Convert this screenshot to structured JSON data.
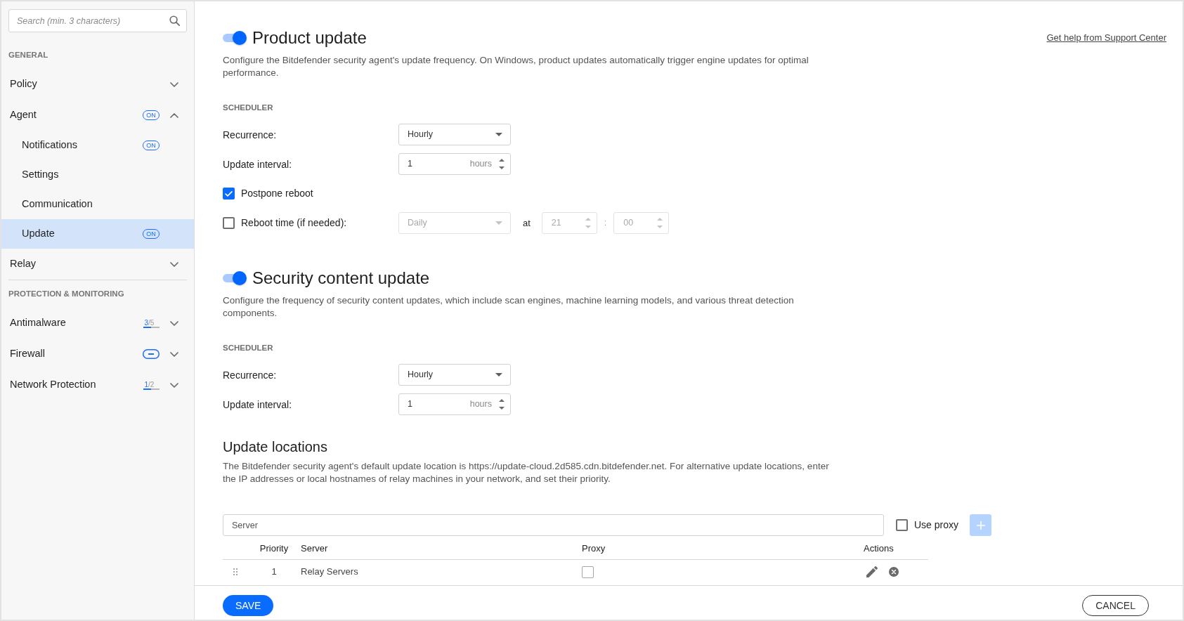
{
  "sidebar": {
    "search": {
      "placeholder": "Search (min. 3 characters)"
    },
    "sections": [
      {
        "heading": "GENERAL",
        "items": [
          {
            "label": "Policy",
            "selected": false,
            "expanded": false
          },
          {
            "label": "Agent",
            "selected": false,
            "expanded": true,
            "badge": {
              "kind": "on",
              "text": "ON"
            },
            "children": [
              {
                "label": "Notifications",
                "selected": false,
                "badge": {
                  "kind": "on",
                  "text": "ON"
                }
              },
              {
                "label": "Settings",
                "selected": false
              },
              {
                "label": "Communication",
                "selected": false
              },
              {
                "label": "Update",
                "selected": true,
                "badge": {
                  "kind": "on",
                  "text": "ON"
                }
              }
            ]
          },
          {
            "label": "Relay",
            "selected": false,
            "expanded": false
          }
        ]
      },
      {
        "heading": "PROTECTION & MONITORING",
        "items": [
          {
            "label": "Antimalware",
            "selected": false,
            "expanded": false,
            "badge": {
              "kind": "ratio",
              "count": "3",
              "total": "/5",
              "level": 0.5
            }
          },
          {
            "label": "Firewall",
            "selected": false,
            "expanded": false,
            "badge": {
              "kind": "dash"
            }
          },
          {
            "label": "Network Protection",
            "selected": false,
            "expanded": false,
            "badge": {
              "kind": "ratio",
              "count": "1",
              "total": "/2",
              "level": 0.5
            }
          }
        ]
      }
    ]
  },
  "update_sections": [
    {
      "enabled": true,
      "title": "Product update",
      "help_link": "Get help from Support Center",
      "description": "Configure the Bitdefender security agent's update frequency. On Windows, product updates automatically trigger engine updates for optimal performance.",
      "scheduler": {
        "heading": "SCHEDULER",
        "fields": [
          {
            "kind": "select",
            "label": "Recurrence:",
            "value": "Hourly"
          },
          {
            "kind": "number",
            "label": "Update interval:",
            "value": "1",
            "unit": "hours"
          },
          {
            "kind": "checkbox",
            "label": "Postpone reboot",
            "checked": true
          },
          {
            "kind": "reboot-time",
            "label": "Reboot time (if needed):",
            "checked": false,
            "schedule": {
              "disabled": true,
              "frequency": "Daily",
              "at": "at",
              "hour": "21",
              "separator": ":",
              "minute": "00"
            }
          }
        ]
      }
    },
    {
      "enabled": true,
      "title": "Security content update",
      "description": "Configure the frequency of security content updates, which include scan engines, machine learning models, and various threat detection components.",
      "scheduler": {
        "heading": "SCHEDULER",
        "fields": [
          {
            "kind": "select",
            "label": "Recurrence:",
            "value": "Hourly"
          },
          {
            "kind": "number",
            "label": "Update interval:",
            "value": "1",
            "unit": "hours"
          }
        ]
      }
    }
  ],
  "update_locations": {
    "title": "Update locations",
    "description": "The Bitdefender security agent's default update location is https://update-cloud.2d585.cdn.bitdefender.net. For alternative update locations, enter the IP addresses or local hostnames of relay machines in your network, and set their priority.",
    "server_input": {
      "placeholder": "Server"
    },
    "use_proxy": {
      "label": "Use proxy",
      "checked": false
    },
    "add_button": {
      "disabled": true
    },
    "table": {
      "columns": [
        "Priority",
        "Server",
        "Proxy",
        "Actions"
      ],
      "rows": [
        {
          "priority": "1",
          "server": "Relay Servers",
          "proxy": false
        }
      ]
    }
  },
  "footer": {
    "save": "SAVE",
    "cancel": "CANCEL"
  }
}
